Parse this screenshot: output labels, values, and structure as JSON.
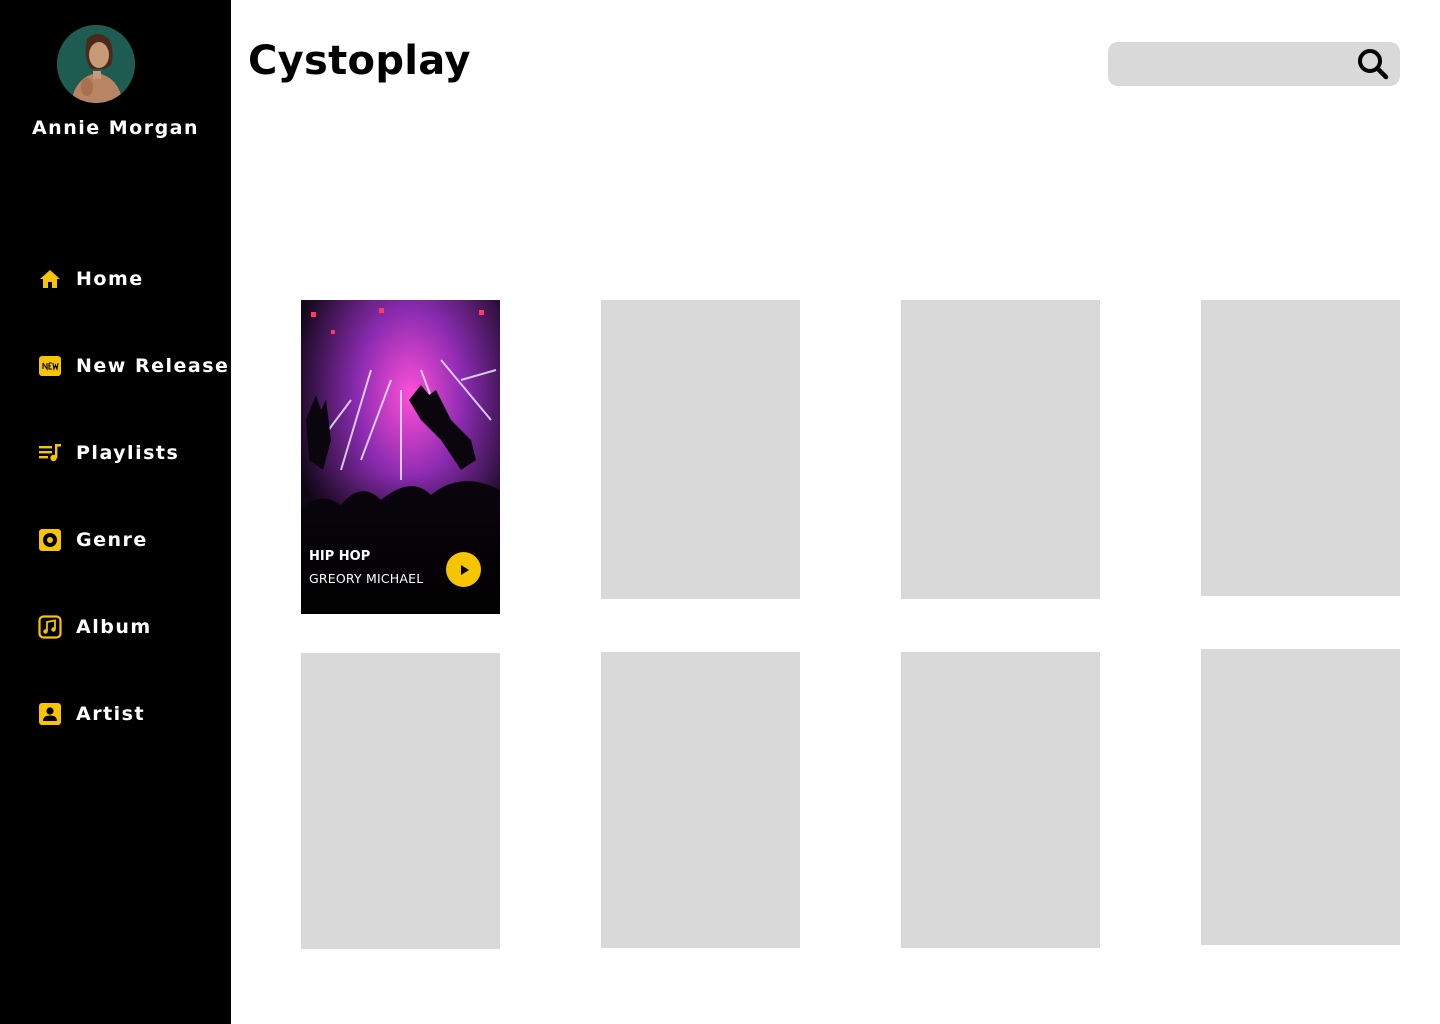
{
  "app": {
    "title": "Cystoplay"
  },
  "user": {
    "name": "Annie Morgan"
  },
  "search": {
    "placeholder": "",
    "value": ""
  },
  "sidebar": {
    "items": [
      {
        "label": "Home",
        "icon": "home-icon"
      },
      {
        "label": "New Release",
        "icon": "new-badge-icon"
      },
      {
        "label": "Playlists",
        "icon": "playlist-icon"
      },
      {
        "label": "Genre",
        "icon": "genre-disc-icon"
      },
      {
        "label": "Album",
        "icon": "album-music-note-icon"
      },
      {
        "label": "Artist",
        "icon": "artist-contact-icon"
      }
    ]
  },
  "featured_card": {
    "genre": "HIP HOP",
    "artist": "GREORY MICHAEL"
  },
  "theme": {
    "accent": "#f7c500",
    "sidebar_bg": "#000000",
    "placeholder": "#d9d9d9"
  }
}
